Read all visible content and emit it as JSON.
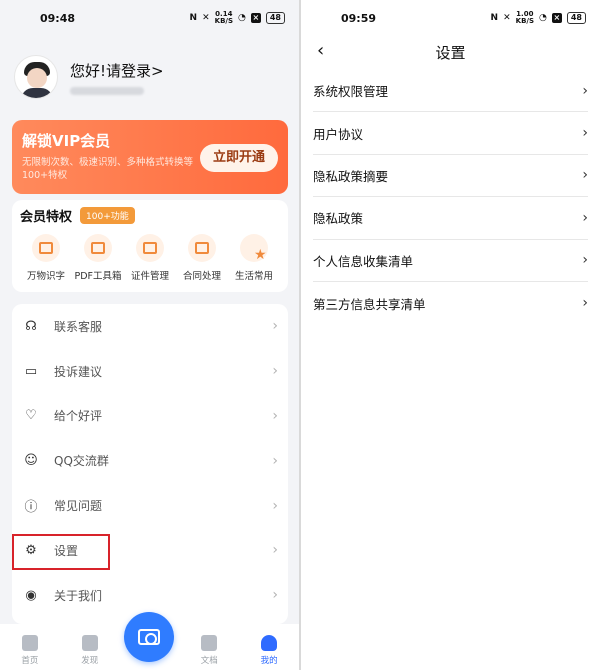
{
  "left": {
    "status": {
      "time": "09:48",
      "net_speed": "0.14\nKB/S",
      "battery": "48"
    },
    "profile": {
      "greeting": "您好!请登录>"
    },
    "vip": {
      "title": "解锁VIP会员",
      "desc": "无限制次数、极速识别、多种格式转换等100+特权",
      "button": "立即开通"
    },
    "privileges": {
      "title": "会员特权",
      "badge": "100+功能",
      "items": [
        {
          "label": "万物识字",
          "icon": "scan-text-icon"
        },
        {
          "label": "PDF工具箱",
          "icon": "pdf-toolbox-icon"
        },
        {
          "label": "证件管理",
          "icon": "id-card-icon"
        },
        {
          "label": "合同处理",
          "icon": "contract-icon"
        },
        {
          "label": "生活常用",
          "icon": "star-icon"
        }
      ]
    },
    "menu": [
      {
        "label": "联系客服",
        "icon": "headset-icon"
      },
      {
        "label": "投诉建议",
        "icon": "message-icon"
      },
      {
        "label": "给个好评",
        "icon": "heart-icon"
      },
      {
        "label": "QQ交流群",
        "icon": "qq-icon"
      },
      {
        "label": "常见问题",
        "icon": "alert-icon"
      },
      {
        "label": "设置",
        "icon": "gear-icon"
      },
      {
        "label": "关于我们",
        "icon": "user-circle-icon"
      }
    ],
    "tabs": [
      {
        "label": "首页",
        "icon": "home-icon"
      },
      {
        "label": "发现",
        "icon": "cube-icon"
      },
      {
        "label": "",
        "icon": "camera-plus-icon"
      },
      {
        "label": "文档",
        "icon": "document-icon"
      },
      {
        "label": "我的",
        "icon": "profile-icon"
      }
    ]
  },
  "right": {
    "status": {
      "time": "09:59",
      "net_speed": "1.00\nKB/S",
      "battery": "48"
    },
    "title": "设置",
    "items": [
      "系统权限管理",
      "用户协议",
      "隐私政策摘要",
      "隐私政策",
      "个人信息收集清单",
      "第三方信息共享清单"
    ]
  },
  "colors": {
    "accent": "#2f7cff",
    "vip_orange": "#ff6a3d",
    "highlight_red": "#d8232a"
  }
}
